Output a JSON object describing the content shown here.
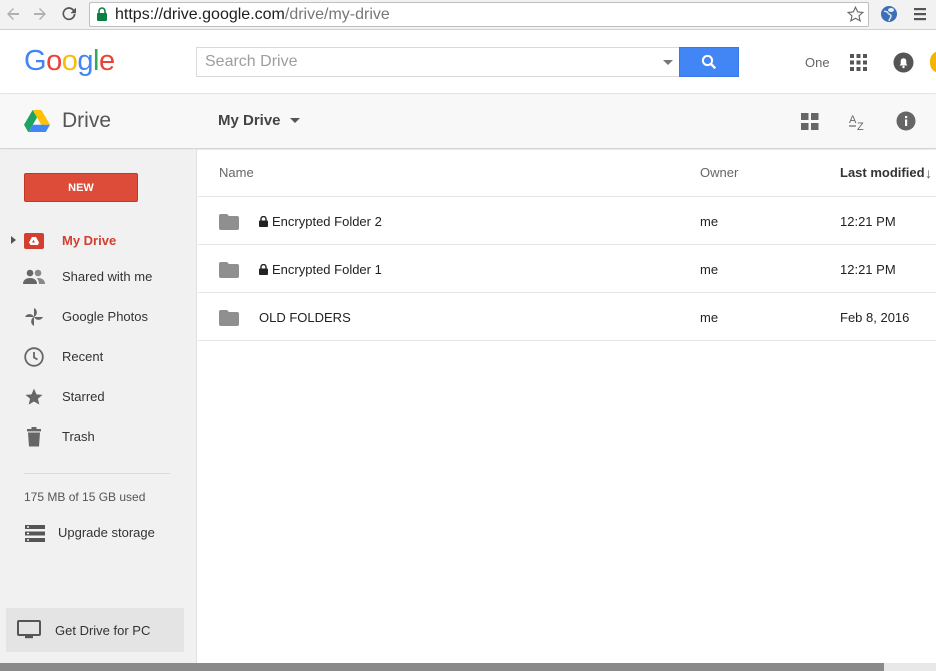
{
  "browser": {
    "url_secure": "https://drive.google.com",
    "url_path": "/drive/my-drive"
  },
  "google_bar": {
    "logo_letters": [
      {
        "ch": "G",
        "color": "#4285f4"
      },
      {
        "ch": "o",
        "color": "#ea4335"
      },
      {
        "ch": "o",
        "color": "#fbbc05"
      },
      {
        "ch": "g",
        "color": "#4285f4"
      },
      {
        "ch": "l",
        "color": "#34a853"
      },
      {
        "ch": "e",
        "color": "#ea4335"
      }
    ],
    "search_placeholder": "Search Drive",
    "account_name": "One"
  },
  "drive_header": {
    "title": "Drive",
    "breadcrumb": "My Drive"
  },
  "sidebar": {
    "new_label": "NEW",
    "items": [
      {
        "label": "My Drive",
        "icon": "my-drive-icon",
        "active": true
      },
      {
        "label": "Shared with me",
        "icon": "people-icon",
        "active": false
      },
      {
        "label": "Google Photos",
        "icon": "pinwheel-icon",
        "active": false
      },
      {
        "label": "Recent",
        "icon": "clock-icon",
        "active": false
      },
      {
        "label": "Starred",
        "icon": "star-icon",
        "active": false
      },
      {
        "label": "Trash",
        "icon": "trash-icon",
        "active": false
      }
    ],
    "quota": "175 MB of 15 GB used",
    "upgrade_label": "Upgrade storage",
    "get_drive_label": "Get Drive for PC"
  },
  "file_list": {
    "columns": {
      "name": "Name",
      "owner": "Owner",
      "modified": "Last modified"
    },
    "rows": [
      {
        "name": "Encrypted Folder 2",
        "locked": true,
        "owner": "me",
        "modified": "12:21 PM"
      },
      {
        "name": "Encrypted Folder 1",
        "locked": true,
        "owner": "me",
        "modified": "12:21 PM"
      },
      {
        "name": "OLD FOLDERS",
        "locked": false,
        "owner": "me",
        "modified": "Feb 8, 2016"
      }
    ]
  },
  "colors": {
    "accent_red": "#dd4b39",
    "search_blue": "#4285f4"
  }
}
